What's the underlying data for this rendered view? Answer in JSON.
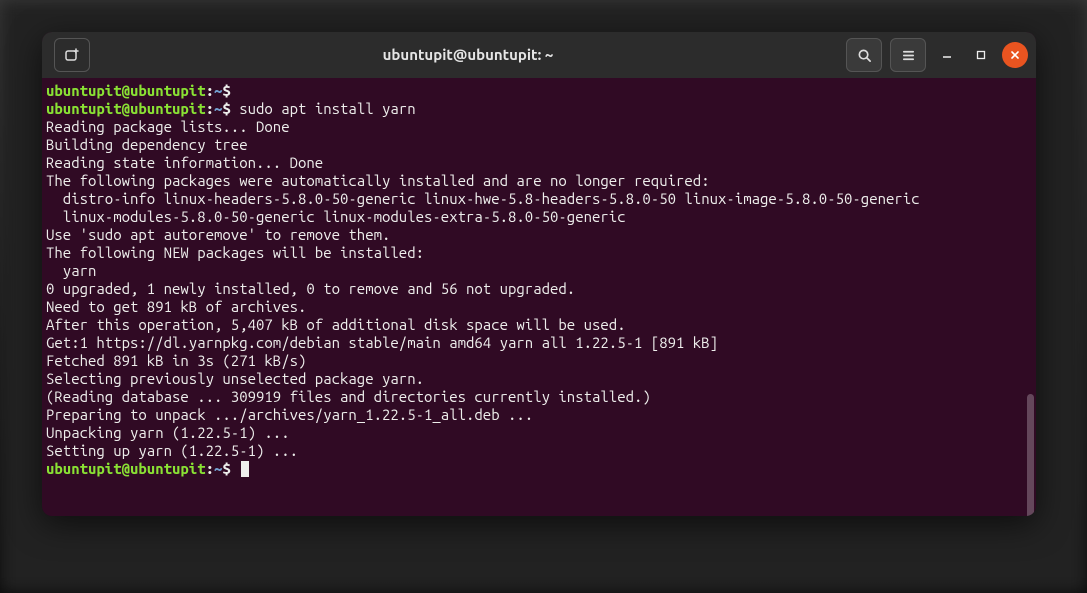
{
  "window": {
    "title": "ubuntupit@ubuntupit: ~"
  },
  "prompt": {
    "userhost": "ubuntupit@ubuntupit",
    "separator": ":",
    "path": "~",
    "symbol": "$"
  },
  "commands": {
    "first_empty": "",
    "install": " sudo apt install yarn"
  },
  "output": {
    "l1": "Reading package lists... Done",
    "l2": "Building dependency tree",
    "l3": "Reading state information... Done",
    "l4": "The following packages were automatically installed and are no longer required:",
    "l5": "  distro-info linux-headers-5.8.0-50-generic linux-hwe-5.8-headers-5.8.0-50 linux-image-5.8.0-50-generic",
    "l6": "  linux-modules-5.8.0-50-generic linux-modules-extra-5.8.0-50-generic",
    "l7": "Use 'sudo apt autoremove' to remove them.",
    "l8": "The following NEW packages will be installed:",
    "l9": "  yarn",
    "l10": "0 upgraded, 1 newly installed, 0 to remove and 56 not upgraded.",
    "l11": "Need to get 891 kB of archives.",
    "l12": "After this operation, 5,407 kB of additional disk space will be used.",
    "l13": "Get:1 https://dl.yarnpkg.com/debian stable/main amd64 yarn all 1.22.5-1 [891 kB]",
    "l14": "Fetched 891 kB in 3s (271 kB/s)",
    "l15": "Selecting previously unselected package yarn.",
    "l16": "(Reading database ... 309919 files and directories currently installed.)",
    "l17": "Preparing to unpack .../archives/yarn_1.22.5-1_all.deb ...",
    "l18": "Unpacking yarn (1.22.5-1) ...",
    "l19": "Setting up yarn (1.22.5-1) ..."
  },
  "icons": {
    "new_tab": "new-tab-icon",
    "search": "search-icon",
    "menu": "hamburger-icon",
    "minimize": "minimize-icon",
    "maximize": "maximize-icon",
    "close": "close-icon"
  },
  "colors": {
    "terminal_bg": "#300a24",
    "prompt_user": "#8ae234",
    "prompt_path": "#729fcf",
    "text": "#eeeeec",
    "close_btn": "#e95420"
  }
}
